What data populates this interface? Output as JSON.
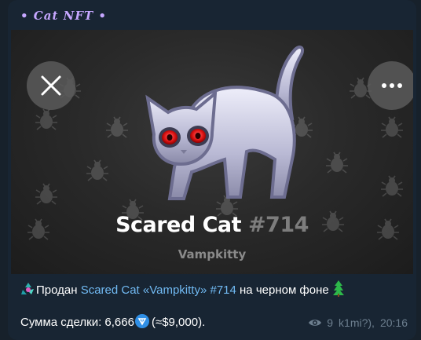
{
  "channel": {
    "title": "• 𝑪𝒂𝒕 𝑵𝑭𝑻 •"
  },
  "gift": {
    "name": "Scared Cat",
    "number": "#714",
    "model": "Vampkitty"
  },
  "caption": {
    "prefix": "Продан ",
    "link": "Scared Cat «Vampkitty» #714",
    "suffix": " на черном фоне",
    "sum_label": "Сумма сделки: 6,666",
    "sum_suffix": "(≈$9,000)."
  },
  "meta": {
    "views": "9",
    "author": "k1mi?),",
    "time": "20:16"
  },
  "icons": [
    "close-icon",
    "more-icon",
    "eye-icon",
    "ton-icon",
    "recycle-emoji",
    "tree-emoji",
    "bug-pattern-icon"
  ],
  "colors": {
    "accent_link": "#71baf3",
    "channel_title": "#c6a7ff",
    "bubble": "#182533"
  }
}
